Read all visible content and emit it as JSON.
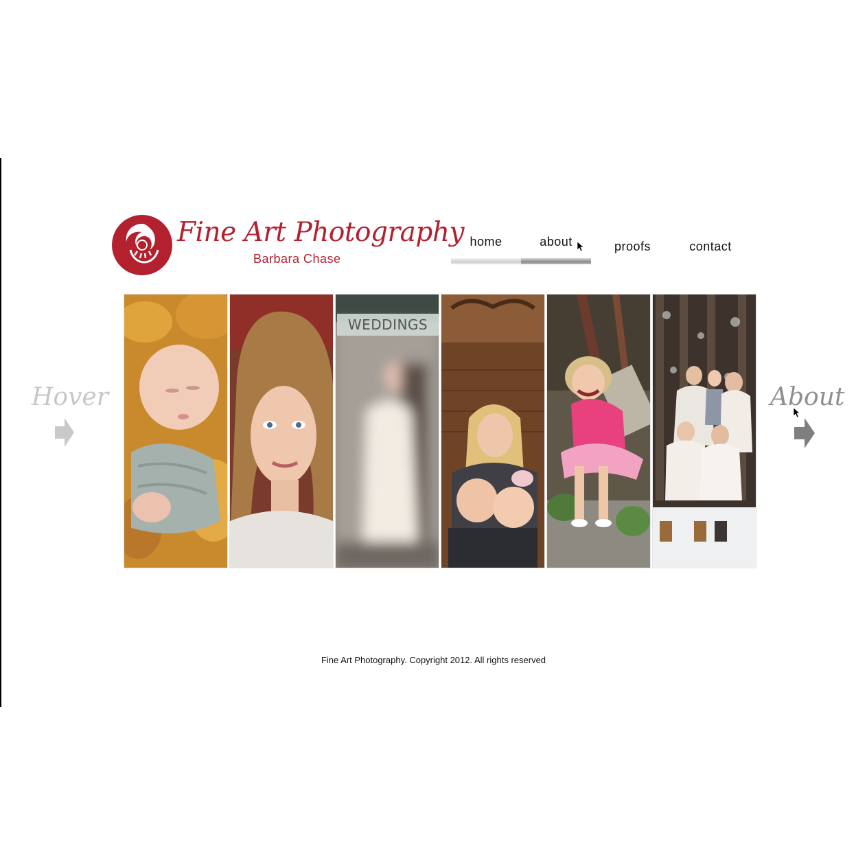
{
  "brand": {
    "title": "Fine Art Photography",
    "subtitle": "Barbara Chase",
    "color": "#b3202e"
  },
  "nav": {
    "items": [
      {
        "label": "home",
        "state": "tab"
      },
      {
        "label": "about",
        "state": "hover"
      },
      {
        "label": "proofs",
        "state": "plain"
      },
      {
        "label": "contact",
        "state": "plain"
      }
    ]
  },
  "gallery": {
    "panels": [
      {
        "subject": "sleeping baby in autumn leaves"
      },
      {
        "subject": "young woman portrait"
      },
      {
        "subject": "blurred bride and groom",
        "overlay_label": "WEDDINGS"
      },
      {
        "subject": "mother with two children on wood floor"
      },
      {
        "subject": "laughing girl in pink dress"
      },
      {
        "subject": "family in snowy forest"
      }
    ]
  },
  "side_nav": {
    "left_label": "Hover",
    "right_label": "About",
    "icons": [
      "arrow-right-icon",
      "arrow-right-icon"
    ]
  },
  "footer": {
    "text": "Fine Art Photography. Copyright 2012. All rights reserved"
  }
}
